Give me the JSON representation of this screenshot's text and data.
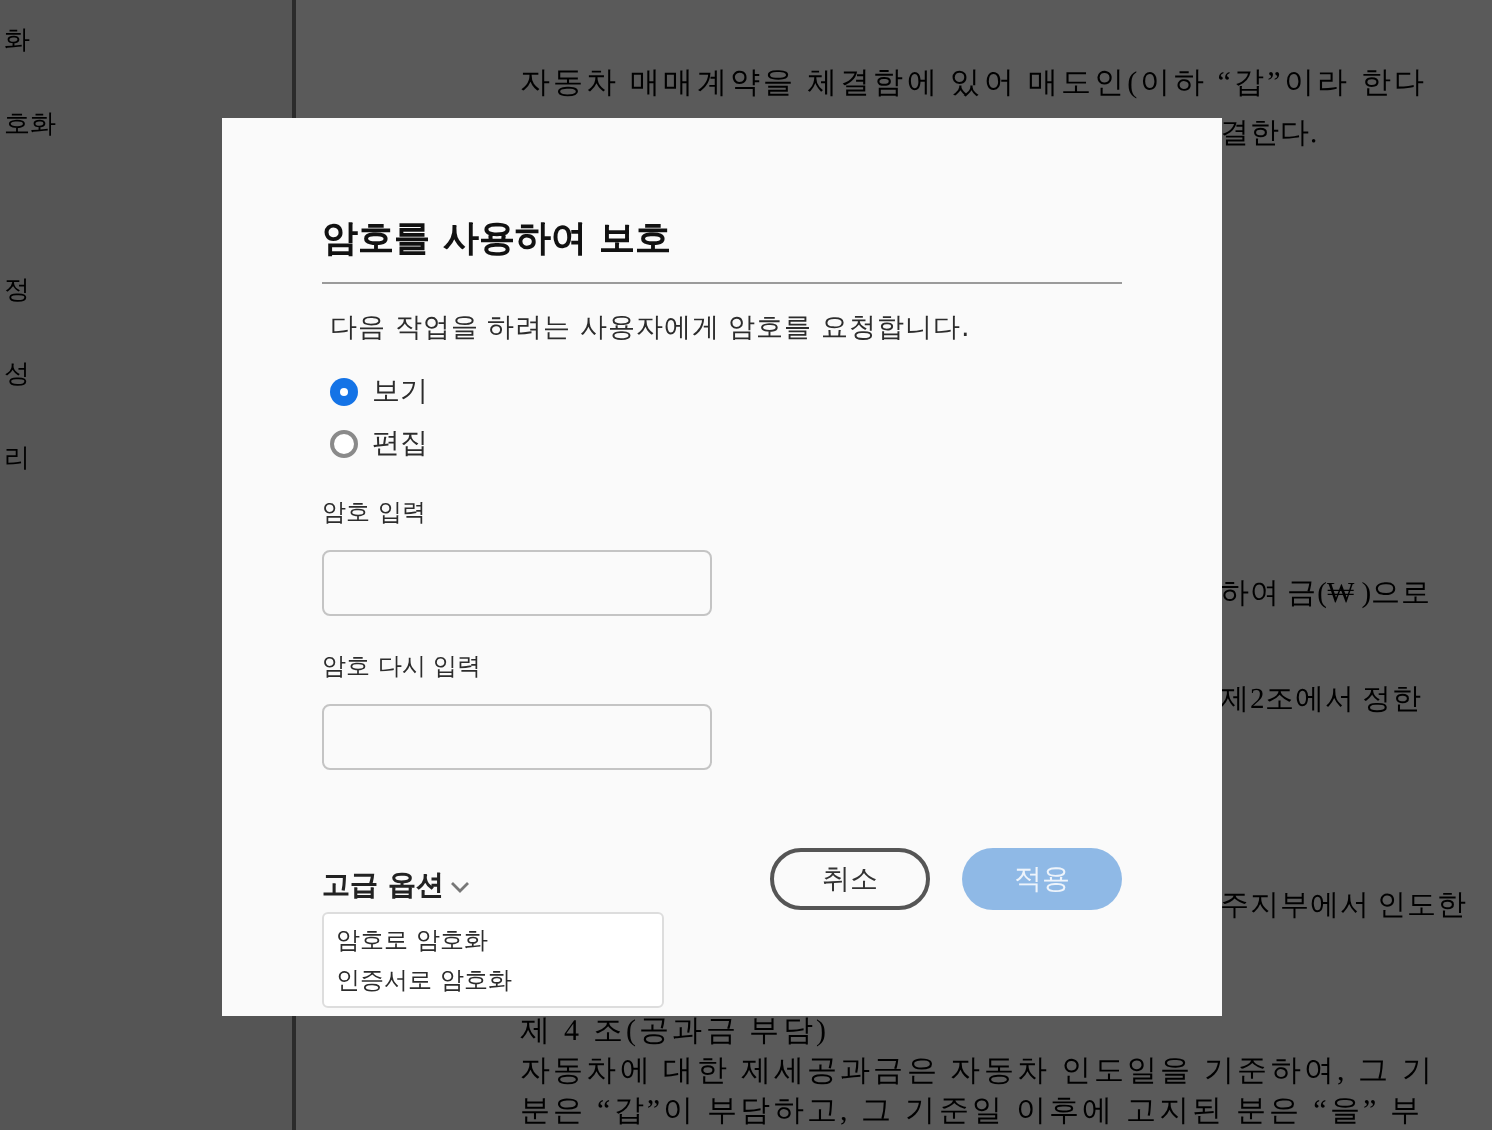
{
  "sidebar": {
    "items": [
      "화",
      "호화",
      "정",
      "성",
      "리"
    ]
  },
  "document": {
    "paragraphs": [
      {
        "kind": "full",
        "lines": [
          "자동차 매매계약을 체결함에 있어 매도인(이하 “갑”이라 한다"
        ]
      },
      {
        "kind": "partial",
        "lines": [
          "결한다."
        ]
      },
      {
        "kind": "partial",
        "lines": [
          "하여 금(₩ )으로"
        ]
      },
      {
        "kind": "partial",
        "lines": [
          "제2조에서 정한"
        ]
      },
      {
        "kind": "partial",
        "lines": [
          "주지부에서 인도한"
        ]
      },
      {
        "kind": "full",
        "lines": [
          "제 4 조(공과금 부담)",
          "자동차에 대한 제세공과금은 자동차 인도일을 기준하여, 그 기",
          "분은 “갑”이 부담하고, 그 기준일 이후에 고지된 분은 “을” 부"
        ]
      }
    ]
  },
  "dialog": {
    "title": "암호를 사용하여 보호",
    "description": "다음 작업을 하려는 사용자에게 암호를 요청합니다.",
    "options": [
      {
        "label": "보기",
        "selected": true
      },
      {
        "label": "편집",
        "selected": false
      }
    ],
    "fields": [
      {
        "label": "암호 입력"
      },
      {
        "label": "암호 다시 입력"
      }
    ],
    "advanced": {
      "label": "고급 옵션",
      "expanded": true,
      "items": [
        "암호로 암호화",
        "인증서로 암호화"
      ]
    },
    "buttons": [
      {
        "label": "취소",
        "kind": "secondary",
        "disabled": false
      },
      {
        "label": "적용",
        "kind": "primary",
        "disabled": true
      }
    ]
  }
}
